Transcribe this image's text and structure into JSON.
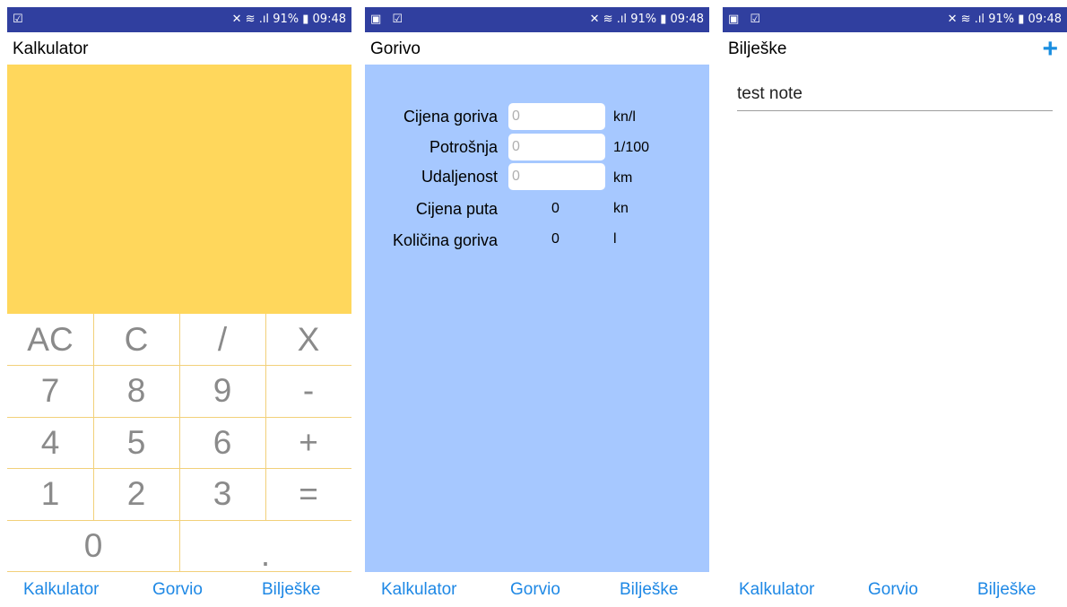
{
  "status": {
    "time": "09:48",
    "battery": "91%",
    "left_icons_1": "☑",
    "left_icons_2": "▣ ☑",
    "signal_icons": "✕ ≋ .ıl"
  },
  "nav": {
    "items": [
      "Kalkulator",
      "Gorvio",
      "Bilješke"
    ]
  },
  "calculator": {
    "title": "Kalkulator",
    "display_color": "#ffd75c",
    "keys": {
      "ac": "AC",
      "c": "C",
      "div": "/",
      "mul": "X",
      "k7": "7",
      "k8": "8",
      "k9": "9",
      "minus": "-",
      "k4": "4",
      "k5": "5",
      "k6": "6",
      "plus": "+",
      "k1": "1",
      "k2": "2",
      "k3": "3",
      "eq": "=",
      "k0": "0",
      "dot": "."
    }
  },
  "fuel": {
    "title": "Gorivo",
    "bg_color": "#a6c8ff",
    "price": {
      "label": "Cijena goriva",
      "placeholder": "0",
      "unit": "kn/l"
    },
    "consumption": {
      "label": "Potrošnja",
      "placeholder": "0",
      "unit": "1/100"
    },
    "distance": {
      "label": "Udaljenost",
      "placeholder": "0",
      "unit": "km"
    },
    "trip_cost": {
      "label": "Cijena puta",
      "value": "0",
      "unit": "kn"
    },
    "fuel_amount": {
      "label": "Količina goriva",
      "value": "0",
      "unit": "l"
    }
  },
  "notes": {
    "title": "Bilješke",
    "add_icon": "+",
    "items": [
      "test note"
    ]
  },
  "colors": {
    "status_bar": "#303f9f",
    "accent": "#1e88e5"
  }
}
